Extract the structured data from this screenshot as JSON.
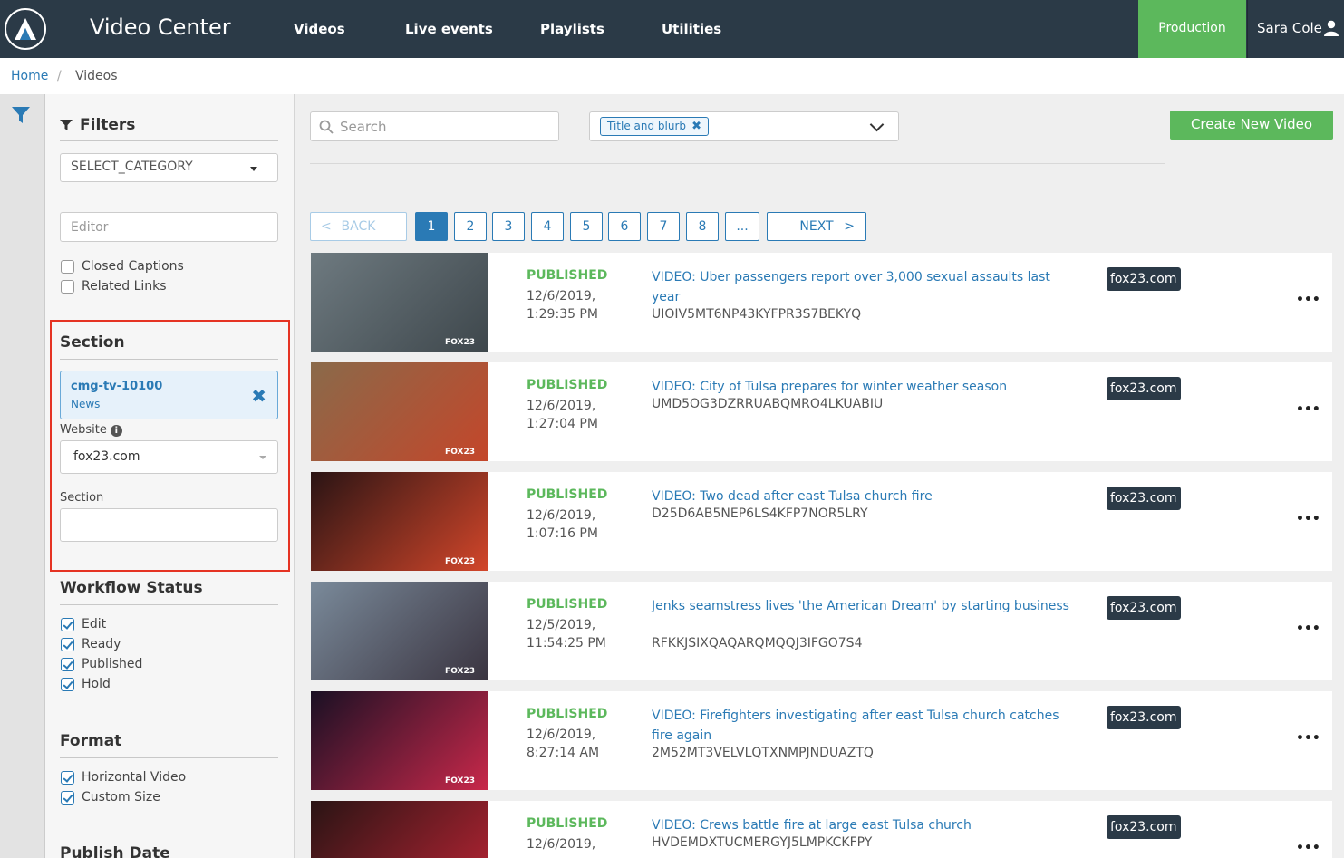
{
  "header": {
    "app_title": "Video Center",
    "nav": [
      "Videos",
      "Live events",
      "Playlists",
      "Utilities"
    ],
    "environment": "Production",
    "user": "Sara Cole"
  },
  "breadcrumb": {
    "home": "Home",
    "separator": "/",
    "current": "Videos"
  },
  "filters": {
    "title": "Filters",
    "category_select": "SELECT_CATEGORY",
    "editor_placeholder": "Editor",
    "checkboxes": [
      {
        "label": "Closed Captions",
        "checked": false
      },
      {
        "label": "Related Links",
        "checked": false
      }
    ],
    "section": {
      "title": "Section",
      "chip_primary": "cmg-tv-10100",
      "chip_secondary": "News",
      "website_label": "Website",
      "website_value": "fox23.com",
      "section_label": "Section"
    },
    "workflow": {
      "title": "Workflow Status",
      "items": [
        {
          "label": "Edit",
          "checked": true
        },
        {
          "label": "Ready",
          "checked": true
        },
        {
          "label": "Published",
          "checked": true
        },
        {
          "label": "Hold",
          "checked": true
        }
      ]
    },
    "format": {
      "title": "Format",
      "items": [
        {
          "label": "Horizontal Video",
          "checked": true
        },
        {
          "label": "Custom Size",
          "checked": true
        }
      ]
    },
    "publish_date_title": "Publish Date"
  },
  "toolbar": {
    "search_placeholder": "Search",
    "search_tag": "Title and blurb",
    "create_button": "Create New Video"
  },
  "pagination": {
    "back": "BACK",
    "pages": [
      "1",
      "2",
      "3",
      "4",
      "5",
      "6",
      "7",
      "8",
      "..."
    ],
    "active": "1",
    "next": "NEXT"
  },
  "videos": [
    {
      "status": "PUBLISHED",
      "date": "12/6/2019,",
      "time": "1:29:35 PM",
      "title": "VIDEO: Uber passengers report over 3,000 sexual assaults last year",
      "id": "UIOIV5MT6NP43KYFPR3S7BEKYQ",
      "site": "fox23.com",
      "thumb_colors": [
        "#6e7a80",
        "#3e474c"
      ]
    },
    {
      "status": "PUBLISHED",
      "date": "12/6/2019,",
      "time": "1:27:04 PM",
      "title": "VIDEO: City of Tulsa prepares for winter weather season",
      "id": "UMD5OG3DZRRUABQMRO4LKUABIU",
      "site": "fox23.com",
      "thumb_colors": [
        "#8a6a4a",
        "#c4462a"
      ]
    },
    {
      "status": "PUBLISHED",
      "date": "12/6/2019,",
      "time": "1:07:16 PM",
      "title": "VIDEO: Two dead after east Tulsa church fire",
      "id": "D25D6AB5NEP6LS4KFP7NOR5LRY",
      "site": "fox23.com",
      "thumb_colors": [
        "#2a1414",
        "#d2462a"
      ]
    },
    {
      "status": "PUBLISHED",
      "date": "12/5/2019,",
      "time": "11:54:25 PM",
      "title": "Jenks seamstress lives 'the American Dream' by starting business",
      "id": "RFKKJSIXQAQARQMQQJ3IFGO7S4",
      "site": "fox23.com",
      "thumb_colors": [
        "#7a8a9a",
        "#3a3440"
      ]
    },
    {
      "status": "PUBLISHED",
      "date": "12/6/2019,",
      "time": "8:27:14 AM",
      "title": "VIDEO: Firefighters investigating after east Tulsa church catches fire again",
      "id": "2M52MT3VELVLQTXNMPJNDUAZTQ",
      "site": "fox23.com",
      "thumb_colors": [
        "#1a1024",
        "#c8284a"
      ]
    },
    {
      "status": "PUBLISHED",
      "date": "12/6/2019,",
      "time": "",
      "title": "VIDEO: Crews battle fire at large east Tulsa church",
      "id": "HVDEMDXTUCMERGYJ5LMPKCKFPY",
      "site": "fox23.com",
      "thumb_colors": [
        "#2a1414",
        "#b82434"
      ]
    }
  ],
  "thumb_brand": "FOX23",
  "colors": {
    "nav_bg": "#2b3a47",
    "accent": "#2a7ab5",
    "success": "#5cb85c",
    "highlight_border": "#e53323"
  }
}
